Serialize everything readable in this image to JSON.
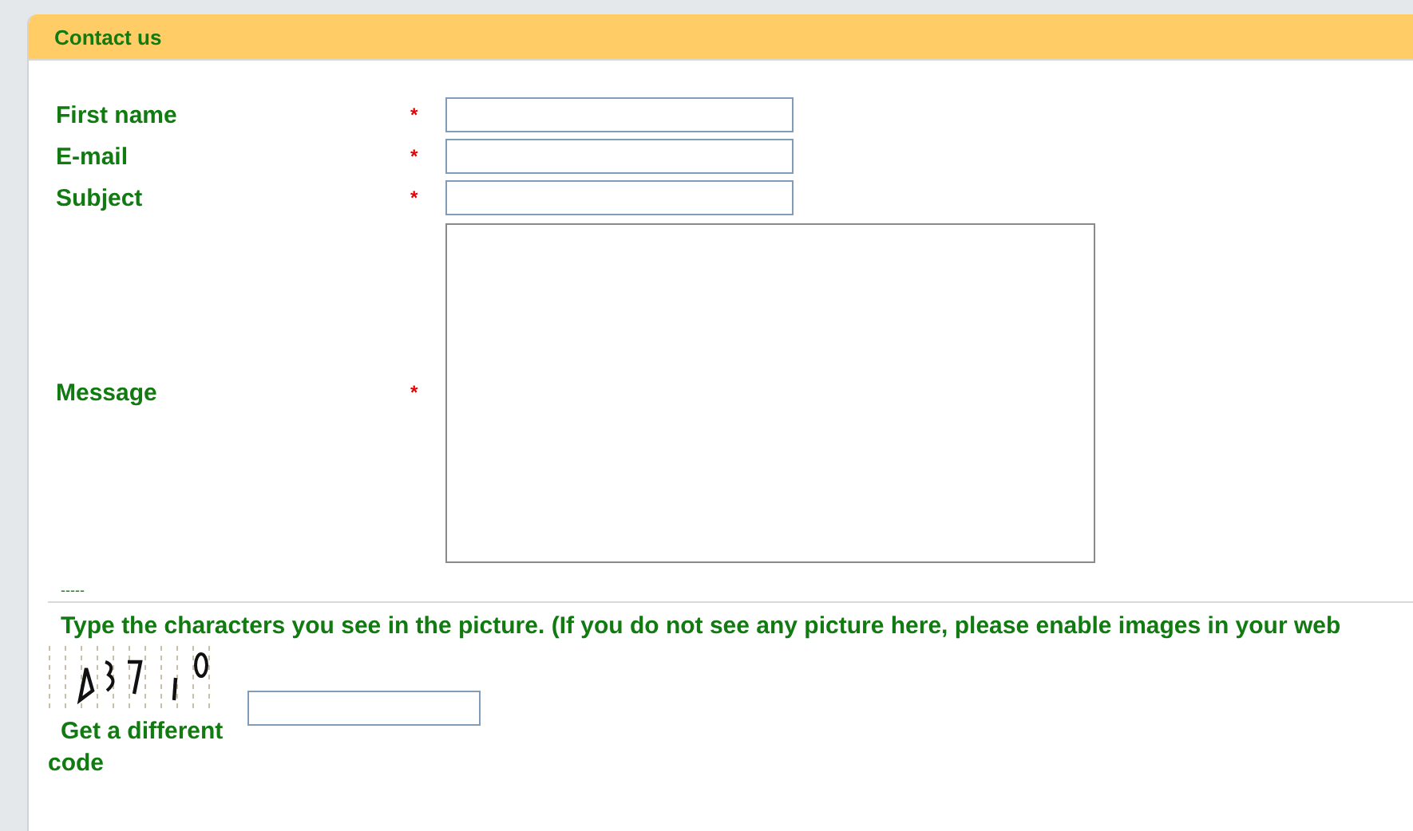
{
  "panel": {
    "title": "Contact us"
  },
  "fields": [
    {
      "label": "First name",
      "required": "*",
      "kind": "input"
    },
    {
      "label": "E-mail",
      "required": "*",
      "kind": "input"
    },
    {
      "label": "Subject",
      "required": "*",
      "kind": "input"
    },
    {
      "label": "Message",
      "required": "*",
      "kind": "textarea"
    }
  ],
  "separator": "-----",
  "captcha": {
    "instruction": "Type the characters you see in the picture. (If you do not see any picture here, please enable images in your web",
    "refresh_link": "Get a different code"
  }
}
